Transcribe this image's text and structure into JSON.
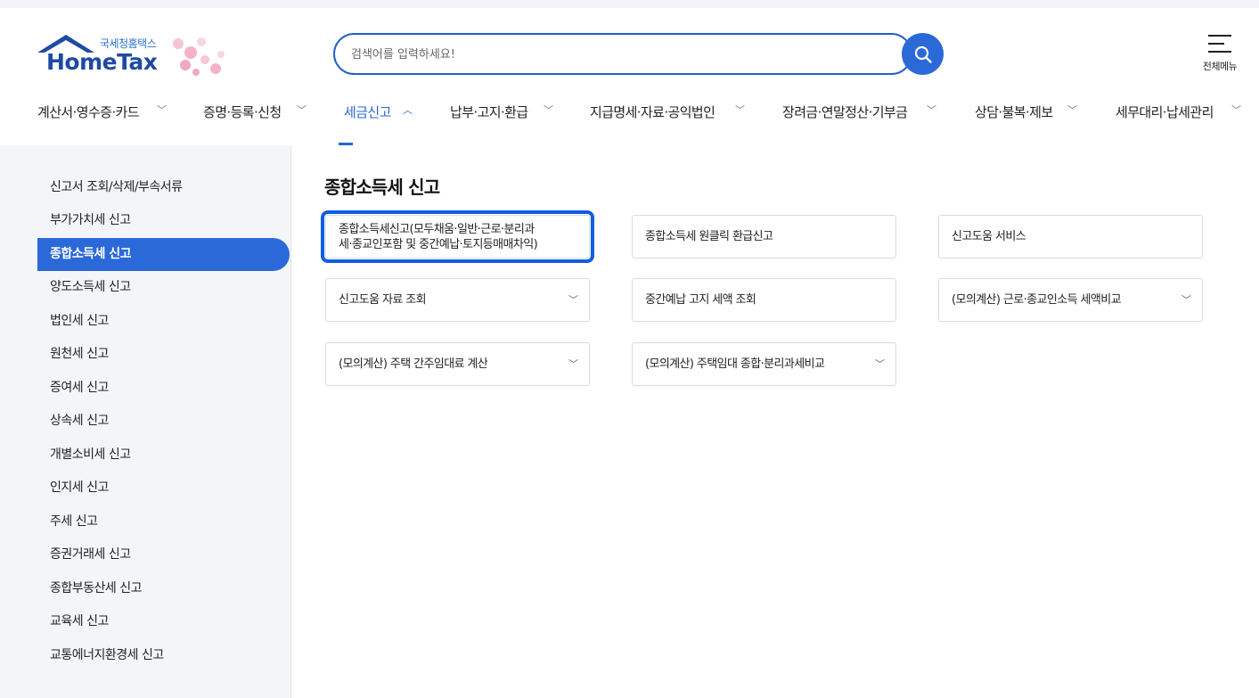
{
  "header": {
    "logo_sub": "국세청홈택스",
    "logo_main": "HomeTax",
    "search_placeholder": "검색어를 입력하세요!",
    "menu_all_label": "전체메뉴"
  },
  "gnb": [
    {
      "label": "계산서·영수증·카드",
      "active": false
    },
    {
      "label": "증명·등록·신청",
      "active": false
    },
    {
      "label": "세금신고",
      "active": true
    },
    {
      "label": "납부·고지·환급",
      "active": false
    },
    {
      "label": "지급명세·자료·공익법인",
      "active": false
    },
    {
      "label": "장려금·연말정산·기부금",
      "active": false
    },
    {
      "label": "상담·불복·제보",
      "active": false
    },
    {
      "label": "세무대리·납세관리",
      "active": false
    }
  ],
  "sidebar": {
    "items": [
      {
        "label": "신고서 조회/삭제/부속서류"
      },
      {
        "label": "부가가치세 신고"
      },
      {
        "label": "종합소득세 신고"
      },
      {
        "label": "양도소득세 신고"
      },
      {
        "label": "법인세 신고"
      },
      {
        "label": "원천세 신고"
      },
      {
        "label": "증여세 신고"
      },
      {
        "label": "상속세 신고"
      },
      {
        "label": "개별소비세 신고"
      },
      {
        "label": "인지세 신고"
      },
      {
        "label": "주세 신고"
      },
      {
        "label": "증권거래세 신고"
      },
      {
        "label": "종합부동산세 신고"
      },
      {
        "label": "교육세 신고"
      },
      {
        "label": "교통에너지환경세 신고"
      }
    ],
    "active_label": "종합소득세 신고"
  },
  "main": {
    "title": "종합소득세 신고",
    "cards": [
      {
        "label_line1": "종합소득세신고(모두채움·일반·근로·분리과",
        "label_line2": "세·종교인포함 및 중간예납·토지등매매차익)",
        "has_dropdown": false,
        "highlighted": true
      },
      {
        "label": "종합소득세 원클릭 환급신고",
        "has_dropdown": false
      },
      {
        "label": "신고도움 서비스",
        "has_dropdown": false
      },
      {
        "label": "신고도움 자료 조회",
        "has_dropdown": true
      },
      {
        "label": "중간예납 고지 세액 조회",
        "has_dropdown": false
      },
      {
        "label": "(모의계산) 근로·종교인소득 세액비교",
        "has_dropdown": true
      },
      {
        "label": "(모의계산) 주택 간주임대료 계산",
        "has_dropdown": true
      },
      {
        "label": "(모의계산) 주택임대 종합·분리과세비교",
        "has_dropdown": true
      }
    ]
  },
  "icons": {
    "search": "search-icon",
    "menu": "hamburger-icon",
    "chevron_down": "chevron-down-icon",
    "chevron_up": "chevron-up-icon"
  },
  "colors": {
    "brand_blue": "#2b69d9",
    "logo_navy": "#1d4ba3",
    "highlight_outline": "#0f5fe0",
    "sidebar_bg": "#f4f5f8"
  }
}
